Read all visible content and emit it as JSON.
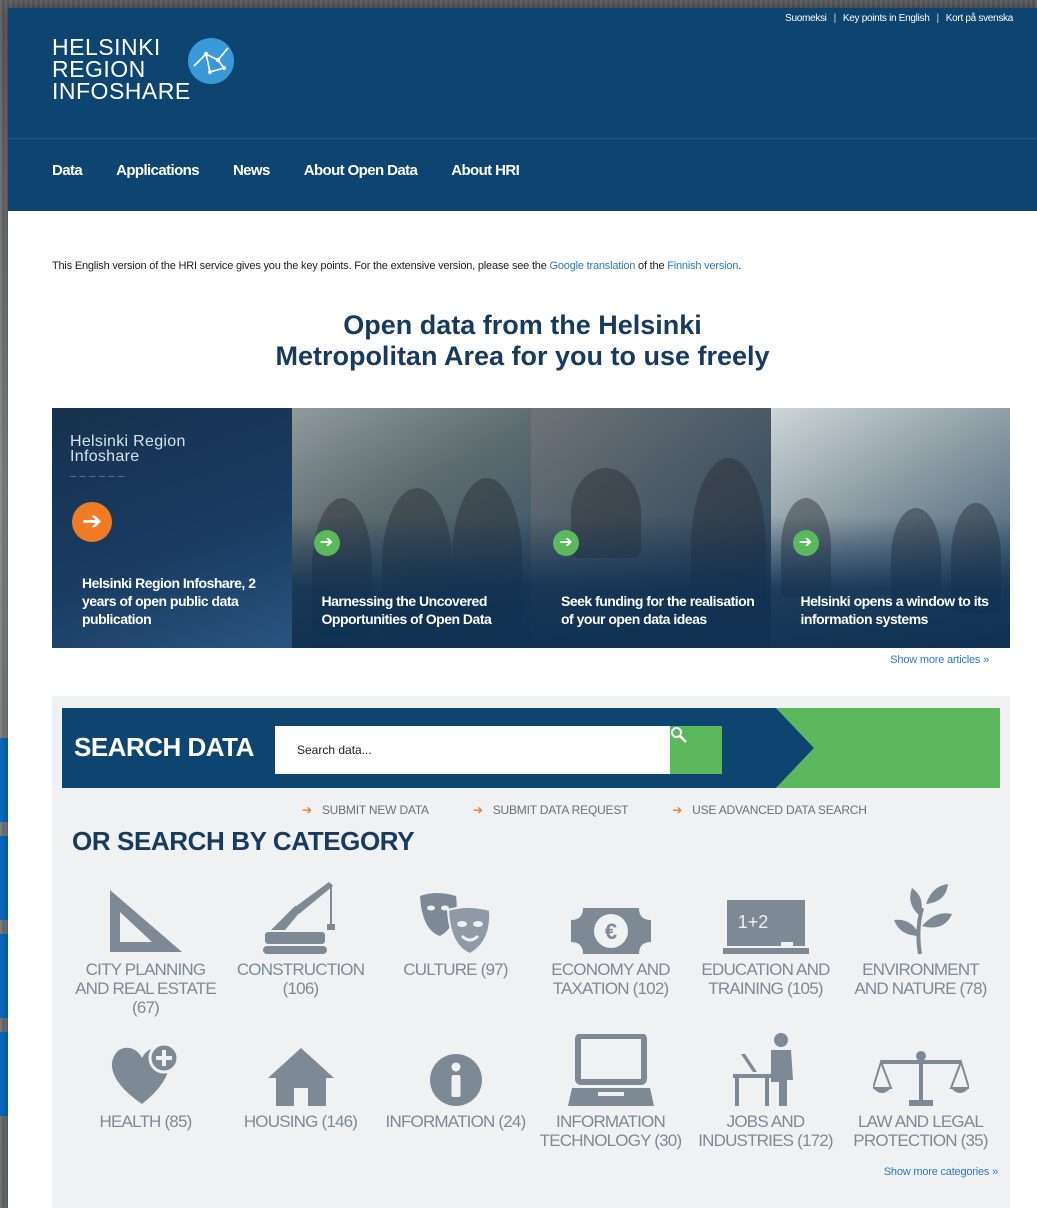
{
  "header": {
    "lang_links": [
      "Suomeksi",
      "Key points in English",
      "Kort på svenska"
    ],
    "logo_lines": [
      "HELSINKI",
      "REGION",
      "INFOSHARE"
    ]
  },
  "nav": {
    "items": [
      "Data",
      "Applications",
      "News",
      "About Open Data",
      "About HRI"
    ]
  },
  "intro": {
    "text_before": "This English version of the HRI service gives you the key points. For the extensive version, please see the ",
    "link1": "Google translation",
    "text_middle": " of the ",
    "link2": "Finnish version",
    "text_after": "."
  },
  "headline": {
    "line1": "Open data from the Helsinki",
    "line2": "Metropolitan Area for you to use freely"
  },
  "articles": {
    "brand_lines": [
      "Helsinki Region",
      "Infoshare"
    ],
    "tiles": [
      "Helsinki Region Infoshare, 2 years of open public data publication",
      "Harnessing the Uncovered Opportunities of Open Data",
      "Seek funding for the realisation of your open data ideas",
      "Helsinki opens a window to its information systems"
    ],
    "show_more": "Show more articles »"
  },
  "search": {
    "title": "SEARCH DATA",
    "placeholder": "Search data...",
    "links": [
      "SUBMIT NEW DATA",
      "SUBMIT DATA REQUEST",
      "USE ADVANCED DATA SEARCH"
    ],
    "category_title": "OR SEARCH BY CATEGORY",
    "categories": [
      {
        "label": "CITY PLANNING AND REAL ESTATE (67)",
        "icon": "set-square-icon"
      },
      {
        "label": "CONSTRUCTION (106)",
        "icon": "crane-icon"
      },
      {
        "label": "CULTURE (97)",
        "icon": "theater-masks-icon"
      },
      {
        "label": "ECONOMY AND TAXATION (102)",
        "icon": "banknote-icon"
      },
      {
        "label": "EDUCATION AND TRAINING (105)",
        "icon": "blackboard-icon"
      },
      {
        "label": "ENVIRONMENT AND NATURE (78)",
        "icon": "plant-icon"
      },
      {
        "label": "HEALTH (85)",
        "icon": "heart-plus-icon"
      },
      {
        "label": "HOUSING (146)",
        "icon": "house-icon"
      },
      {
        "label": "INFORMATION (24)",
        "icon": "info-icon"
      },
      {
        "label": "INFORMATION TECHNOLOGY (30)",
        "icon": "laptop-icon"
      },
      {
        "label": "JOBS AND INDUSTRIES (172)",
        "icon": "worker-desk-icon"
      },
      {
        "label": "LAW AND LEGAL PROTECTION (35)",
        "icon": "scales-icon"
      }
    ],
    "show_more_categories": "Show more categories »"
  },
  "colors": {
    "navy": "#0e4470",
    "heading": "#173a5e",
    "green": "#5cb85c",
    "orange": "#f07b24",
    "link": "#2a7cc0",
    "icon_gray": "#7d8a96"
  }
}
